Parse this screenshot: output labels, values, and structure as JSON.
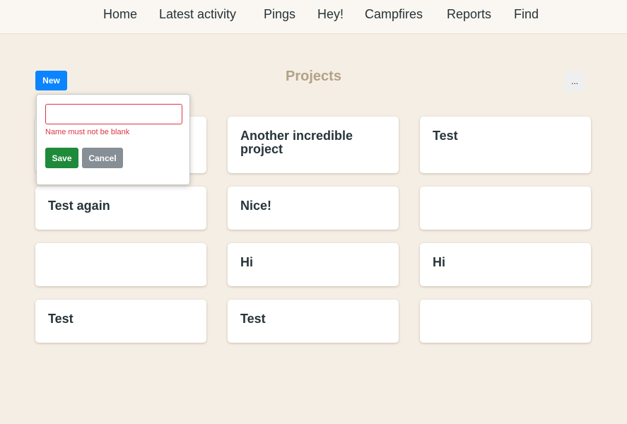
{
  "nav": [
    "Home",
    "Latest activity",
    "Pings",
    "Hey!",
    "Campfires",
    "Reports",
    "Find"
  ],
  "header": {
    "new_label": "New",
    "title": "Projects",
    "more_label": "..."
  },
  "popover": {
    "input_value": "",
    "error": "Name must not be blank",
    "save_label": "Save",
    "cancel_label": "Cancel"
  },
  "projects": [
    "",
    "Another incredible project",
    "Test",
    "Test again",
    "Nice!",
    "",
    "",
    "Hi",
    "Hi",
    "Test",
    "Test",
    ""
  ],
  "colors": {
    "primary": "#0b84ff",
    "success": "#1e8a3a",
    "danger": "#dc3545",
    "secondary": "#868e96",
    "background": "#f5eee4"
  }
}
